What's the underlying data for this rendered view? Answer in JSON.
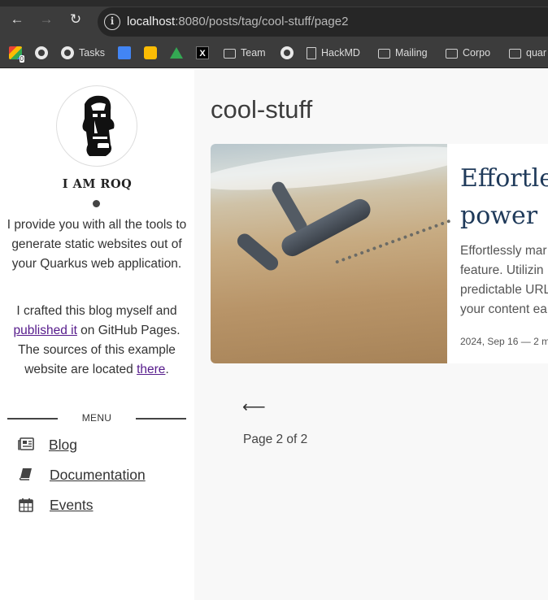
{
  "browser": {
    "url_host": "localhost",
    "url_rest": ":8080/posts/tag/cool-stuff/page2",
    "bookmarks": [
      {
        "label": "",
        "icon": "gmail-icon"
      },
      {
        "label": "",
        "icon": "github-icon"
      },
      {
        "label": "Tasks",
        "icon": "github-icon"
      },
      {
        "label": "",
        "icon": "calendar-icon"
      },
      {
        "label": "",
        "icon": "keep-icon"
      },
      {
        "label": "",
        "icon": "drive-icon"
      },
      {
        "label": "",
        "icon": "x-icon"
      },
      {
        "label": "Team",
        "icon": "folder-icon"
      },
      {
        "label": "",
        "icon": "github-icon"
      },
      {
        "label": "HackMD",
        "icon": "document-icon"
      },
      {
        "label": "Mailing",
        "icon": "folder-icon"
      },
      {
        "label": "Corpo",
        "icon": "folder-icon"
      },
      {
        "label": "quar",
        "icon": "folder-icon"
      }
    ]
  },
  "sidebar": {
    "site_name": "I AM ROQ",
    "bio": "I provide you with all the tools to generate static websites out of your Quarkus web application.",
    "bio2_pre": "I crafted this blog myself and ",
    "bio2_link": "published it",
    "bio2_mid": " on GitHub Pages. The sources of this example website are located ",
    "bio2_link2": "there",
    "bio2_end": ".",
    "menu_label": "MENU",
    "menu": [
      {
        "label": "Blog",
        "icon": "newspaper-icon"
      },
      {
        "label": "Documentation",
        "icon": "book-icon"
      },
      {
        "label": "Events",
        "icon": "calendar-icon"
      }
    ]
  },
  "main": {
    "tag_title": "cool-stuff",
    "post": {
      "title_line1": "Effortles",
      "title_line2": "power",
      "excerpt_lines": [
        "Effortlessly mar",
        "feature. Utilizin",
        "predictable URL",
        "your content ea"
      ],
      "meta": "2024, Sep 16  —  2 m"
    },
    "pagination": {
      "prev_arrow": "⟵",
      "page_info": "Page 2 of 2"
    }
  }
}
